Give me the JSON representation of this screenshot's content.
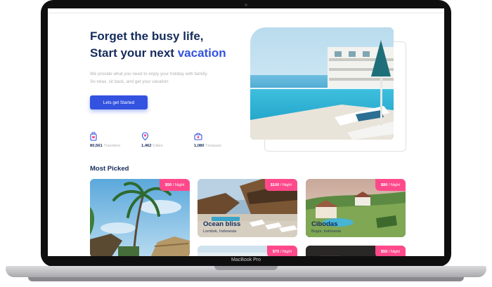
{
  "hero": {
    "title_line1": "Forget the busy life,",
    "title_line2_prefix": "Start your next ",
    "title_line2_accent": "vacation",
    "description_line1": "We provide what you need to enjoy your holiday with familiy.",
    "description_line2": "So relax, sit back, and get your vacation",
    "cta_label": "Lets get Started"
  },
  "stats": [
    {
      "icon": "traveler-icon",
      "value": "80,561",
      "label": "Travelers"
    },
    {
      "icon": "city-icon",
      "value": "1,462",
      "label": "Cities"
    },
    {
      "icon": "treasure-icon",
      "value": "1,080",
      "label": "Treasure"
    }
  ],
  "most_picked": {
    "title": "Most Picked",
    "cards": [
      {
        "price": "$50",
        "unit": "/ Night",
        "name": "",
        "location": ""
      },
      {
        "price": "$100",
        "unit": "/ Night",
        "name": "Ocean bliss",
        "location": "Lombok, Indonesia"
      },
      {
        "price": "$80",
        "unit": "/ Night",
        "name": "Cibodas",
        "location": "Bogor, Indonesia"
      },
      {
        "price": "$75",
        "unit": "/ Night",
        "name": "",
        "location": ""
      },
      {
        "price": "$50",
        "unit": "/ Night",
        "name": "",
        "location": ""
      }
    ]
  },
  "device_label": "MacBook Pro",
  "colors": {
    "primary": "#3252DF",
    "heading": "#152C5B",
    "muted": "#B0B0B0",
    "price_tag": "#FF498B"
  }
}
